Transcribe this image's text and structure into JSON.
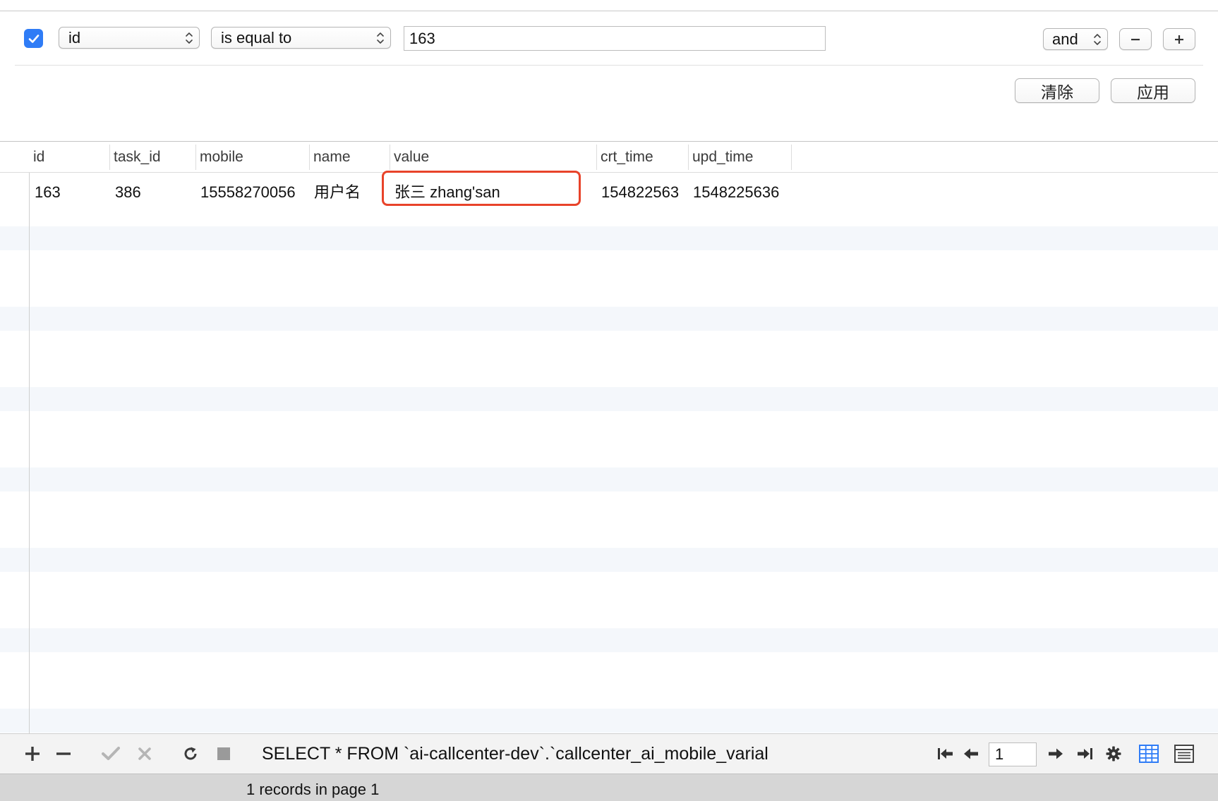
{
  "filter": {
    "enabled": true,
    "field": "id",
    "operator": "is equal to",
    "value": "163",
    "join": "and",
    "remove_label": "−",
    "add_label": "+",
    "clear_label": "清除",
    "apply_label": "应用"
  },
  "table": {
    "columns": [
      "id",
      "task_id",
      "mobile",
      "name",
      "value",
      "crt_time",
      "upd_time"
    ],
    "rows": [
      {
        "id": "163",
        "task_id": "386",
        "mobile": "15558270056",
        "name": "用户名",
        "value": "张三 zhang'san",
        "crt_time": "154822563",
        "upd_time": "1548225636"
      }
    ],
    "highlight_color": "#e8432a"
  },
  "toolbar": {
    "sql": "SELECT * FROM `ai-callcenter-dev`.`callcenter_ai_mobile_varial",
    "page": "1",
    "icons": [
      "plus-icon",
      "minus-icon",
      "checkmark-icon",
      "cross-icon",
      "refresh-icon",
      "stop-icon",
      "first-page-icon",
      "previous-page-icon",
      "next-page-icon",
      "last-page-icon",
      "gear-icon",
      "grid-view-icon",
      "form-view-icon"
    ]
  },
  "status": {
    "text": "1 records in page 1"
  },
  "colors": {
    "accent": "#2f7cf6",
    "highlight": "#e8432a"
  }
}
